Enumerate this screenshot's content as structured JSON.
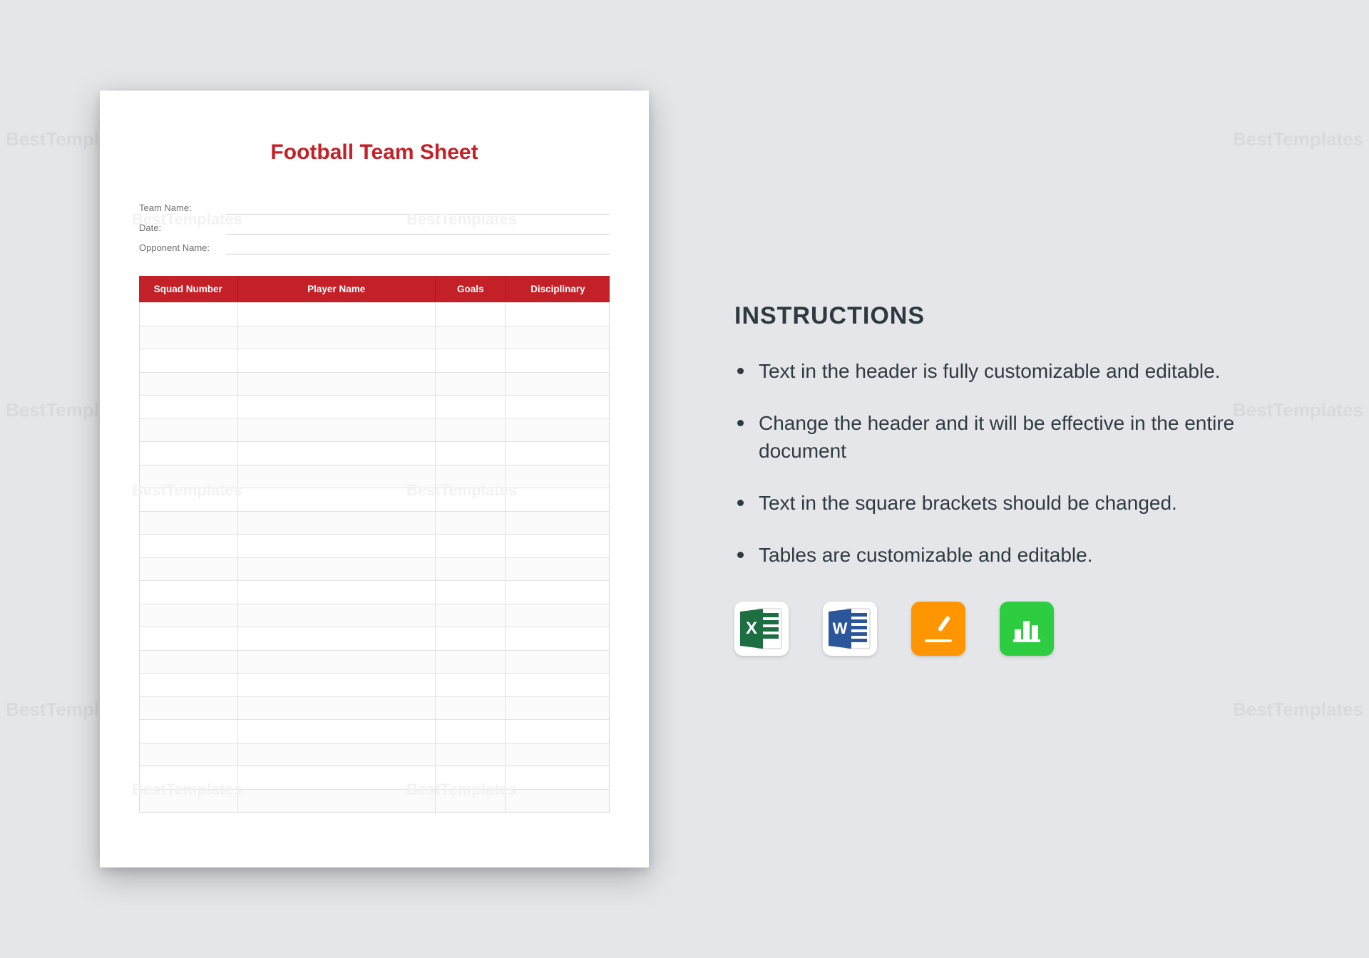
{
  "watermark_text": "BestTemplates",
  "document": {
    "title": "Football Team Sheet",
    "fields": {
      "team": "Team Name:",
      "date": "Date:",
      "opponent": "Opponent Name:"
    },
    "columns": [
      "Squad Number",
      "Player Name",
      "Goals",
      "Disciplinary"
    ],
    "row_count": 22
  },
  "instructions": {
    "heading": "INSTRUCTIONS",
    "items": [
      "Text in the header is fully customizable and editable.",
      "Change the header and it will be effective in the entire document",
      "Text in the square brackets should be changed.",
      "Tables are customizable and editable."
    ]
  },
  "apps": [
    {
      "name": "excel-icon"
    },
    {
      "name": "word-icon"
    },
    {
      "name": "pages-icon"
    },
    {
      "name": "numbers-icon"
    }
  ]
}
